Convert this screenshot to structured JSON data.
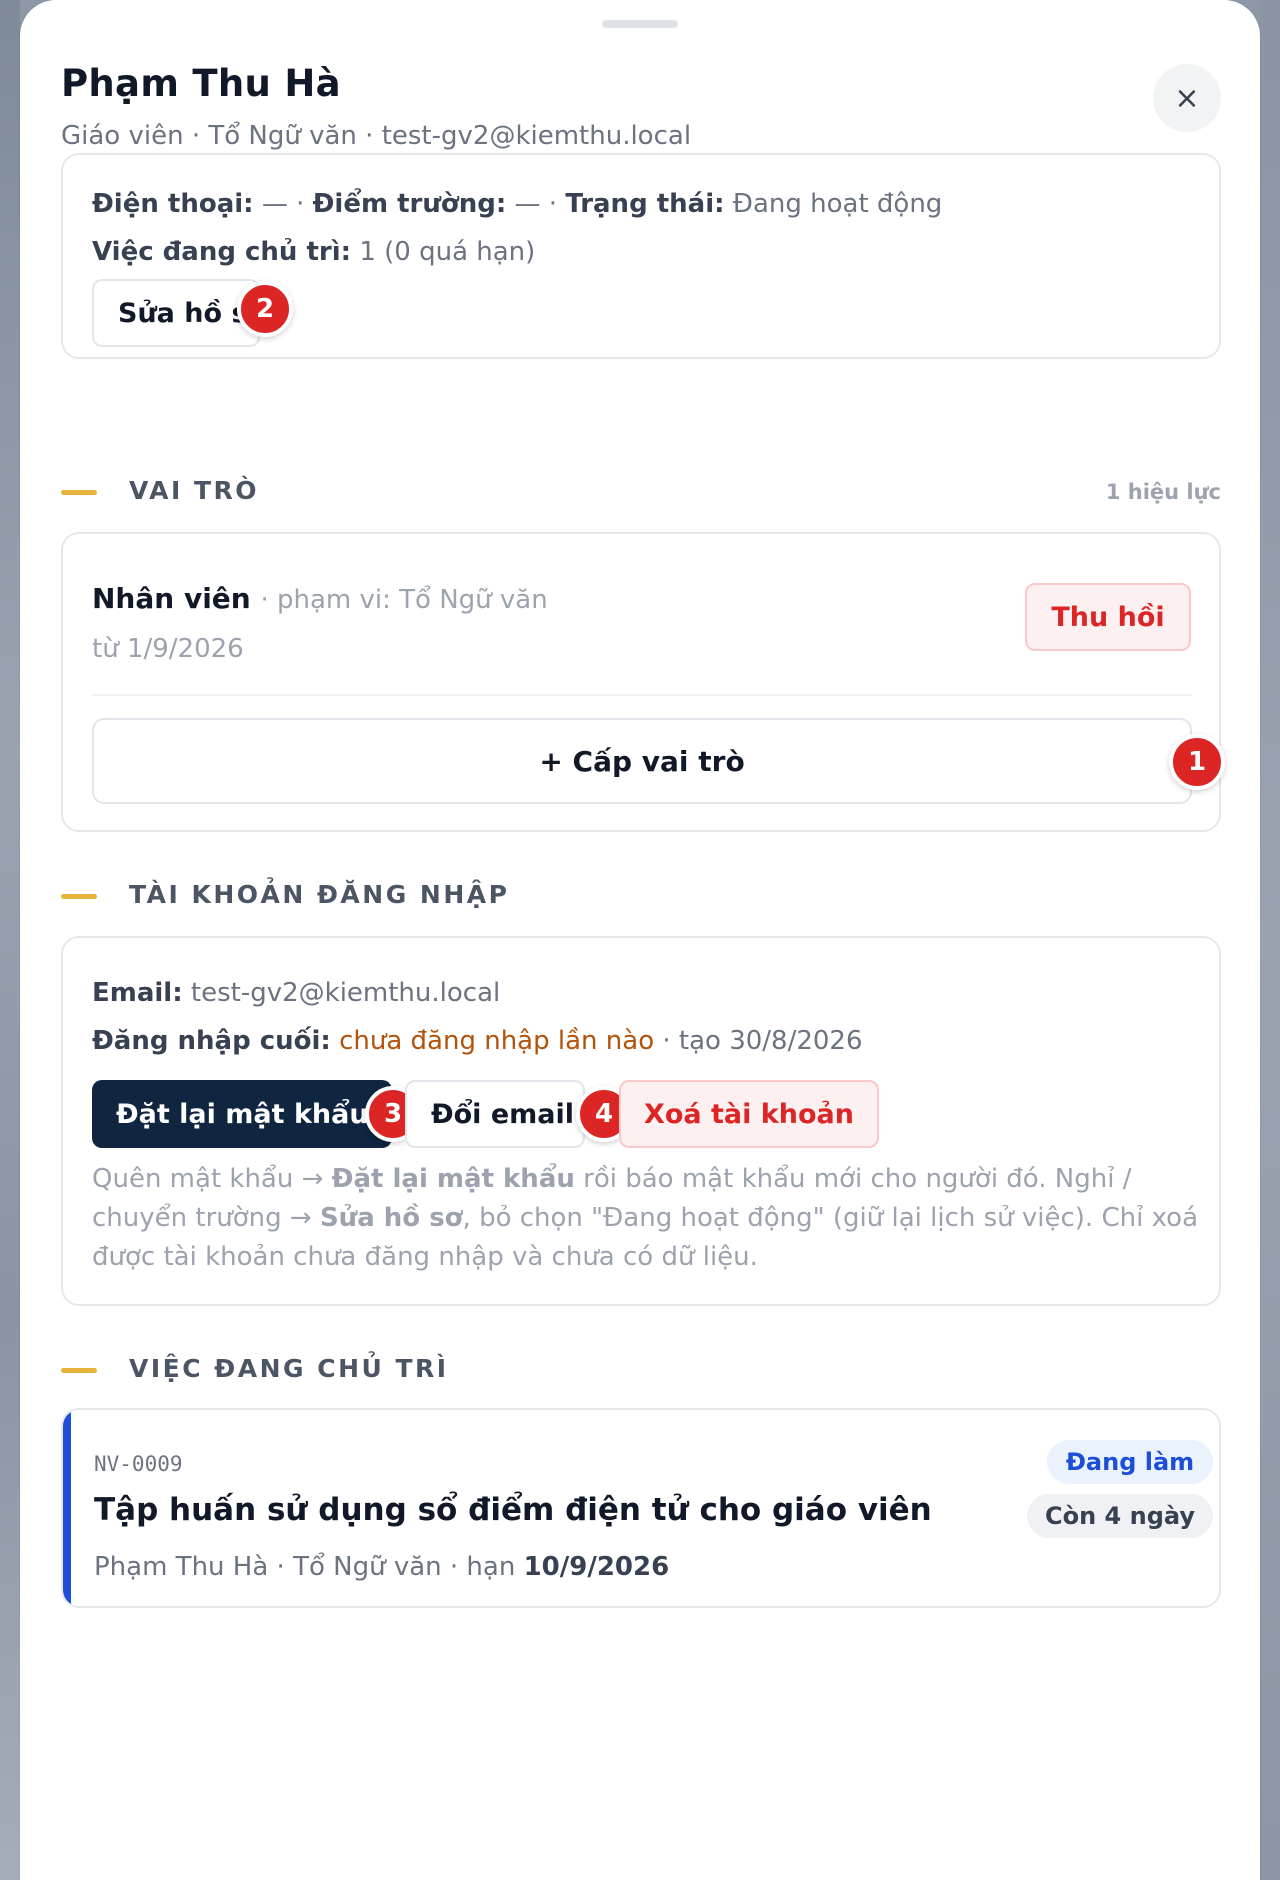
{
  "header": {
    "name": "Phạm Thu Hà",
    "subtitle": "Giáo viên · Tổ Ngữ văn · test-gv2@kiemthu.local",
    "close_label": "×"
  },
  "profile": {
    "phone_label": "Điện thoại:",
    "phone_value": "—",
    "school_label": "Điểm trường:",
    "school_value": "—",
    "status_label": "Trạng thái:",
    "status_value": "Đang hoạt động",
    "tasks_label": "Việc đang chủ trì:",
    "tasks_value": "1 (0 quá hạn)",
    "sep": "·",
    "edit_button": "Sửa hồ sơ",
    "edit_badge": "2"
  },
  "roles": {
    "section_title": "VAI TRÒ",
    "section_count": "1 hiệu lực",
    "items": [
      {
        "name": "Nhân viên",
        "scope": "· phạm vi: Tổ Ngữ văn",
        "since": "từ 1/9/2026",
        "revoke_label": "Thu hồi"
      }
    ],
    "grant_button": "+ Cấp vai trò",
    "grant_badge": "1"
  },
  "account": {
    "section_title": "TÀI KHOẢN ĐĂNG NHẬP",
    "email_label": "Email:",
    "email_value": "test-gv2@kiemthu.local",
    "last_login_label": "Đăng nhập cuối:",
    "last_login_value": "chưa đăng nhập lần nào",
    "created": "· tạo 30/8/2026",
    "reset_button": "Đặt lại mật khẩu",
    "reset_badge": "3",
    "change_email_button": "Đổi email",
    "change_email_badge": "4",
    "delete_button": "Xoá tài khoản",
    "hint_1": "Quên mật khẩu → ",
    "hint_2": "Đặt lại mật khẩu",
    "hint_3": " rồi báo mật khẩu mới cho người đó. Nghỉ / chuyển trường → ",
    "hint_4": "Sửa hồ sơ",
    "hint_5": ", bỏ chọn \"Đang hoạt động\" (giữ lại lịch sử việc). Chỉ xoá được tài khoản chưa đăng nhập và chưa có dữ liệu."
  },
  "tasks": {
    "section_title": "VIỆC ĐANG CHỦ TRÌ",
    "items": [
      {
        "code": "NV-0009",
        "title": "Tập huấn sử dụng sổ điểm điện tử cho giáo viên",
        "meta": "Phạm Thu Hà · Tổ Ngữ văn · hạn ",
        "due": "10/9/2026",
        "status": "Đang làm",
        "remaining": "Còn 4 ngày"
      }
    ]
  },
  "colors": {
    "accent_bar": "#e8b33b",
    "danger": "#dc2626",
    "primary_dark": "#0f2540",
    "task_accent": "#1d4ed8"
  }
}
